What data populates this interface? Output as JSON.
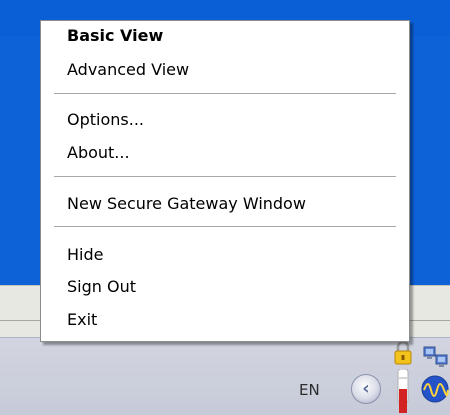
{
  "context_menu": {
    "items": [
      {
        "label": "Basic View",
        "bold": true
      },
      {
        "label": "Advanced View"
      },
      {
        "label": "Options..."
      },
      {
        "label": "About..."
      },
      {
        "label": "New Secure Gateway Window"
      },
      {
        "label": "Hide"
      },
      {
        "label": "Sign Out"
      },
      {
        "label": "Exit"
      }
    ]
  },
  "taskbar": {
    "language": "EN",
    "tray_icons": [
      "network-computers-icon",
      "padlock-icon",
      "red-tube-icon",
      "audio-wave-icon"
    ],
    "show_hidden_icon": "chevron-left-icon"
  },
  "colors": {
    "desktop_blue": "#0d62d8",
    "menu_background": "#ffffff",
    "taskbar": "#cfd2de"
  }
}
